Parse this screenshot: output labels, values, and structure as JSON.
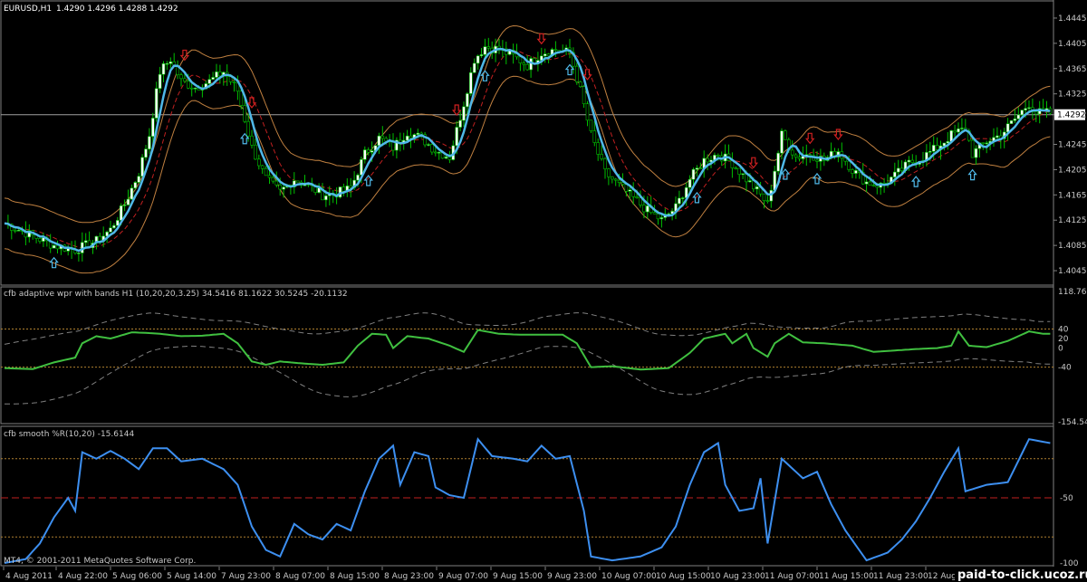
{
  "header": {
    "symbol": "EURUSD,H1",
    "ohlc": "1.4290 1.4296 1.4288 1.4292",
    "panel1_label": "cfb adaptive wpr with bands H1 (10,20,20,3.25) 34.5416 81.1622 30.5245 -20.1132",
    "panel2_label": "cfb smooth %R(10,20) -15.6144",
    "copyright": "MT4, © 2001-2011 MetaQuotes Software Corp.",
    "watermark": "paid-to-click.ucoz.ru"
  },
  "colors": {
    "bull_candle": "#ffffff",
    "bear_candle": "#000000",
    "wick": "#00c000",
    "candle_outline": "#00c000",
    "avg_line": "#4fb8e8",
    "band_outer": "#c08040",
    "band_mid": "#c02020",
    "arrow_up": "#4fb8e8",
    "arrow_down": "#d02020",
    "wpr_line": "#40c040",
    "wpr_band": "#808080",
    "smooth_line": "#3d8ff0",
    "level_dotted": "#b08030",
    "mid_dashed": "#c02020",
    "price_line": "#a0a0a0"
  },
  "chart_data": [
    {
      "type": "line",
      "subtype": "candlestick",
      "title": "EURUSD,H1",
      "series_name": "EURUSD,H1",
      "ylim": [
        1.4025,
        1.4465
      ],
      "y_ticks": [
        "1.4445",
        "1.4405",
        "1.4365",
        "1.4325",
        "1.4292",
        "1.4245",
        "1.4205",
        "1.4165",
        "1.4125",
        "1.4085",
        "1.4045"
      ],
      "current_price": "1.4292",
      "x_ticks": [
        "4 Aug 2011",
        "4 Aug 22:00",
        "5 Aug 06:00",
        "5 Aug 14:00",
        "7 Aug 23:00",
        "8 Aug 07:00",
        "8 Aug 15:00",
        "8 Aug 23:00",
        "9 Aug 07:00",
        "9 Aug 15:00",
        "9 Aug 23:00",
        "10 Aug 07:00",
        "10 Aug 15:00",
        "10 Aug 23:00",
        "11 Aug 07:00",
        "11 Aug 15:00",
        "11 Aug 23:00",
        "12 Aug"
      ],
      "close_path": [
        [
          0,
          1.412
        ],
        [
          8,
          1.41
        ],
        [
          14,
          1.4085
        ],
        [
          20,
          1.4078
        ],
        [
          26,
          1.4092
        ],
        [
          30,
          1.411
        ],
        [
          34,
          1.415
        ],
        [
          38,
          1.42
        ],
        [
          41,
          1.426
        ],
        [
          44,
          1.436
        ],
        [
          47,
          1.438
        ],
        [
          50,
          1.4345
        ],
        [
          54,
          1.4335
        ],
        [
          58,
          1.4345
        ],
        [
          62,
          1.436
        ],
        [
          66,
          1.433
        ],
        [
          70,
          1.424
        ],
        [
          74,
          1.419
        ],
        [
          78,
          1.417
        ],
        [
          82,
          1.419
        ],
        [
          86,
          1.418
        ],
        [
          90,
          1.4165
        ],
        [
          94,
          1.4168
        ],
        [
          98,
          1.4175
        ],
        [
          102,
          1.423
        ],
        [
          106,
          1.4255
        ],
        [
          110,
          1.424
        ],
        [
          114,
          1.4265
        ],
        [
          118,
          1.4255
        ],
        [
          122,
          1.4235
        ],
        [
          126,
          1.4225
        ],
        [
          130,
          1.431
        ],
        [
          133,
          1.438
        ],
        [
          136,
          1.44
        ],
        [
          140,
          1.4395
        ],
        [
          144,
          1.4385
        ],
        [
          148,
          1.437
        ],
        [
          152,
          1.439
        ],
        [
          156,
          1.4395
        ],
        [
          160,
          1.439
        ],
        [
          163,
          1.433
        ],
        [
          166,
          1.426
        ],
        [
          170,
          1.42
        ],
        [
          174,
          1.418
        ],
        [
          178,
          1.416
        ],
        [
          182,
          1.414
        ],
        [
          186,
          1.4125
        ],
        [
          190,
          1.4145
        ],
        [
          194,
          1.419
        ],
        [
          198,
          1.422
        ],
        [
          202,
          1.423
        ],
        [
          206,
          1.4215
        ],
        [
          210,
          1.419
        ],
        [
          214,
          1.4165
        ],
        [
          216,
          1.415
        ],
        [
          220,
          1.426
        ],
        [
          224,
          1.4225
        ],
        [
          228,
          1.423
        ],
        [
          232,
          1.422
        ],
        [
          236,
          1.4235
        ],
        [
          240,
          1.4205
        ],
        [
          244,
          1.4185
        ],
        [
          248,
          1.418
        ],
        [
          252,
          1.4195
        ],
        [
          256,
          1.4215
        ],
        [
          260,
          1.4225
        ],
        [
          264,
          1.424
        ],
        [
          268,
          1.426
        ],
        [
          272,
          1.427
        ],
        [
          274,
          1.423
        ],
        [
          278,
          1.425
        ],
        [
          282,
          1.426
        ],
        [
          286,
          1.4285
        ],
        [
          290,
          1.431
        ],
        [
          292,
          1.4295
        ]
      ]
    },
    {
      "type": "line",
      "title": "cfb adaptive wpr with bands H1 (10,20,20,3.25)",
      "values_printed": [
        "34.5416",
        "81.1622",
        "30.5245",
        "-20.1132"
      ],
      "ylim": [
        -154.5486,
        118.7672
      ],
      "y_ticks": [
        "118.7672",
        "40",
        "20",
        "0",
        "-40",
        "-154.5486"
      ],
      "levels": [
        40,
        -40
      ],
      "wpr": [
        [
          0,
          -42
        ],
        [
          8,
          -44
        ],
        [
          14,
          -30
        ],
        [
          20,
          -20
        ],
        [
          22,
          10
        ],
        [
          26,
          25
        ],
        [
          30,
          20
        ],
        [
          36,
          33
        ],
        [
          40,
          32
        ],
        [
          44,
          30
        ],
        [
          50,
          25
        ],
        [
          56,
          26
        ],
        [
          62,
          30
        ],
        [
          66,
          10
        ],
        [
          70,
          -28
        ],
        [
          74,
          -35
        ],
        [
          78,
          -28
        ],
        [
          84,
          -32
        ],
        [
          90,
          -35
        ],
        [
          96,
          -30
        ],
        [
          100,
          5
        ],
        [
          104,
          30
        ],
        [
          108,
          28
        ],
        [
          110,
          0
        ],
        [
          114,
          25
        ],
        [
          120,
          20
        ],
        [
          126,
          5
        ],
        [
          130,
          -8
        ],
        [
          134,
          38
        ],
        [
          140,
          30
        ],
        [
          146,
          28
        ],
        [
          152,
          28
        ],
        [
          158,
          28
        ],
        [
          162,
          10
        ],
        [
          166,
          -40
        ],
        [
          172,
          -38
        ],
        [
          180,
          -45
        ],
        [
          188,
          -42
        ],
        [
          194,
          -10
        ],
        [
          198,
          20
        ],
        [
          204,
          30
        ],
        [
          206,
          10
        ],
        [
          210,
          30
        ],
        [
          212,
          0
        ],
        [
          216,
          -18
        ],
        [
          218,
          10
        ],
        [
          222,
          30
        ],
        [
          226,
          12
        ],
        [
          232,
          10
        ],
        [
          240,
          5
        ],
        [
          246,
          -8
        ],
        [
          252,
          -5
        ],
        [
          258,
          -2
        ],
        [
          264,
          0
        ],
        [
          268,
          5
        ],
        [
          270,
          35
        ],
        [
          273,
          5
        ],
        [
          278,
          2
        ],
        [
          284,
          15
        ],
        [
          290,
          35
        ],
        [
          294,
          30
        ]
      ]
    },
    {
      "type": "line",
      "title": "cfb smooth %R(10,20)",
      "values_printed": [
        "-15.6144"
      ],
      "ylim": [
        -100,
        0
      ],
      "y_ticks": [
        "-50",
        "-100"
      ],
      "levels": [
        -20,
        -50,
        -80
      ],
      "series": [
        [
          0,
          -100
        ],
        [
          6,
          -97
        ],
        [
          10,
          -85
        ],
        [
          14,
          -65
        ],
        [
          18,
          -50
        ],
        [
          20,
          -60
        ],
        [
          22,
          -15
        ],
        [
          26,
          -20
        ],
        [
          30,
          -14
        ],
        [
          34,
          -20
        ],
        [
          38,
          -28
        ],
        [
          42,
          -12
        ],
        [
          46,
          -12
        ],
        [
          50,
          -22
        ],
        [
          56,
          -20
        ],
        [
          62,
          -28
        ],
        [
          66,
          -40
        ],
        [
          70,
          -72
        ],
        [
          74,
          -90
        ],
        [
          78,
          -95
        ],
        [
          82,
          -70
        ],
        [
          86,
          -78
        ],
        [
          90,
          -82
        ],
        [
          94,
          -70
        ],
        [
          98,
          -75
        ],
        [
          102,
          -45
        ],
        [
          106,
          -20
        ],
        [
          110,
          -10
        ],
        [
          112,
          -40
        ],
        [
          116,
          -15
        ],
        [
          120,
          -18
        ],
        [
          122,
          -42
        ],
        [
          126,
          -48
        ],
        [
          130,
          -50
        ],
        [
          134,
          -5
        ],
        [
          138,
          -18
        ],
        [
          144,
          -20
        ],
        [
          148,
          -22
        ],
        [
          152,
          -10
        ],
        [
          156,
          -20
        ],
        [
          160,
          -18
        ],
        [
          164,
          -60
        ],
        [
          166,
          -95
        ],
        [
          172,
          -98
        ],
        [
          180,
          -95
        ],
        [
          186,
          -88
        ],
        [
          190,
          -72
        ],
        [
          194,
          -40
        ],
        [
          198,
          -15
        ],
        [
          202,
          -8
        ],
        [
          204,
          -40
        ],
        [
          208,
          -60
        ],
        [
          212,
          -58
        ],
        [
          214,
          -35
        ],
        [
          216,
          -85
        ],
        [
          220,
          -20
        ],
        [
          226,
          -35
        ],
        [
          230,
          -30
        ],
        [
          234,
          -55
        ],
        [
          238,
          -75
        ],
        [
          244,
          -98
        ],
        [
          250,
          -92
        ],
        [
          254,
          -82
        ],
        [
          258,
          -68
        ],
        [
          262,
          -50
        ],
        [
          266,
          -30
        ],
        [
          270,
          -12
        ],
        [
          272,
          -45
        ],
        [
          278,
          -40
        ],
        [
          284,
          -38
        ],
        [
          290,
          -5
        ],
        [
          296,
          -8
        ]
      ]
    }
  ]
}
